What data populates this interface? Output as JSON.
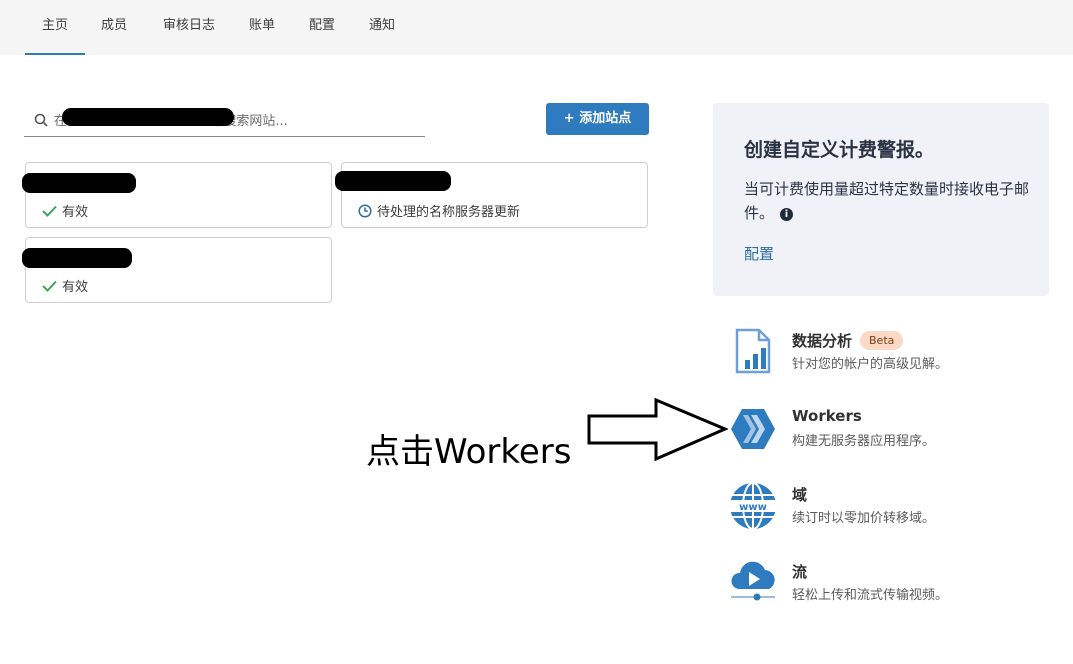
{
  "nav": {
    "tabs": [
      {
        "label": "主页"
      },
      {
        "label": "成员"
      },
      {
        "label": "审核日志"
      },
      {
        "label": "账单"
      },
      {
        "label": "配置"
      },
      {
        "label": "通知"
      }
    ]
  },
  "search": {
    "placeholder": "在                     Account 中搜索网站..."
  },
  "add_site_button": "+ 添加站点",
  "sites": [
    {
      "status": "有效",
      "status_icon": "check-icon"
    },
    {
      "status": "待处理的名称服务器更新",
      "status_icon": "clock-icon"
    },
    {
      "status": "有效",
      "status_icon": "check-icon"
    }
  ],
  "alert": {
    "title": "创建自定义计费警报。",
    "body": "当可计费使用量超过特定数量时接收电子邮件。",
    "link": "配置"
  },
  "products": [
    {
      "name": "数据分析",
      "badge": "Beta",
      "desc": "针对您的帐户的高级见解。",
      "icon": "analytics-icon"
    },
    {
      "name": "Workers",
      "desc": "构建无服务器应用程序。",
      "icon": "workers-icon"
    },
    {
      "name": "域",
      "desc": "续订时以零加价转移域。",
      "icon": "globe-www-icon"
    },
    {
      "name": "流",
      "desc": "轻松上传和流式传输视频。",
      "icon": "stream-cloud-icon"
    }
  ],
  "annotation": {
    "text": "点击Workers"
  },
  "colors": {
    "accent": "#2f7bbf",
    "nav_bg": "#f5f5f5",
    "alert_bg": "#f1f2f7",
    "success": "#3aa356"
  }
}
